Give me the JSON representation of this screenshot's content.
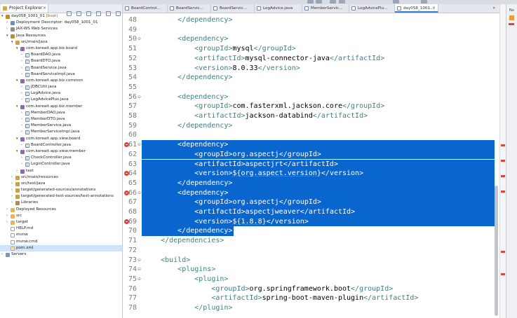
{
  "project_explorer": {
    "tab_label": "Project Explorer",
    "items": [
      {
        "label": "day058_1001_01",
        "suffix": "[boot]",
        "indent": 0,
        "arrow": "▾",
        "icon": "project-icon",
        "cls": "proj"
      },
      {
        "label": "Deployment Descriptor: day058_1001_01",
        "indent": 1,
        "arrow": "›",
        "icon": "deployment-descriptor-icon",
        "cls": "dd"
      },
      {
        "label": "JAX-WS Web Services",
        "indent": 1,
        "arrow": "›",
        "icon": "web-services-icon",
        "cls": "ws"
      },
      {
        "label": "Java Resources",
        "indent": 1,
        "arrow": "▾",
        "icon": "java-resources-icon",
        "cls": "jr"
      },
      {
        "label": "src/main/java",
        "indent": 2,
        "arrow": "▾",
        "icon": "source-folder-icon",
        "cls": "srcf"
      },
      {
        "label": "com.koreait.app.biz.board",
        "indent": 3,
        "arrow": "▾",
        "icon": "package-icon",
        "cls": "pkg"
      },
      {
        "label": "BoardDAO.java",
        "indent": 4,
        "arrow": "›",
        "icon": "java-file-icon",
        "cls": "jf"
      },
      {
        "label": "BoardDTO.java",
        "indent": 4,
        "arrow": "›",
        "icon": "java-file-icon",
        "cls": "jf"
      },
      {
        "label": "BoardService.java",
        "indent": 4,
        "arrow": "›",
        "icon": "java-file-icon",
        "cls": "jf"
      },
      {
        "label": "BoardServiceImpl.java",
        "indent": 4,
        "arrow": "›",
        "icon": "java-file-icon",
        "cls": "jf"
      },
      {
        "label": "com.koreait.app.biz.common",
        "indent": 3,
        "arrow": "▾",
        "icon": "package-icon",
        "cls": "pkg"
      },
      {
        "label": "JDBCUtil.java",
        "indent": 4,
        "arrow": "›",
        "icon": "java-file-icon",
        "cls": "jf"
      },
      {
        "label": "LogAdvice.java",
        "indent": 4,
        "arrow": "›",
        "icon": "java-file-icon",
        "cls": "jf"
      },
      {
        "label": "LogAdvicePlus.java",
        "indent": 4,
        "arrow": "›",
        "icon": "java-file-icon",
        "cls": "jf"
      },
      {
        "label": "com.koreait.app.biz.member",
        "indent": 3,
        "arrow": "▾",
        "icon": "package-icon",
        "cls": "pkg"
      },
      {
        "label": "MemberDAO.java",
        "indent": 4,
        "arrow": "›",
        "icon": "java-file-icon",
        "cls": "jf"
      },
      {
        "label": "MemberDTO.java",
        "indent": 4,
        "arrow": "›",
        "icon": "java-file-icon",
        "cls": "jf"
      },
      {
        "label": "MemberService.java",
        "indent": 4,
        "arrow": "›",
        "icon": "java-file-icon",
        "cls": "jf"
      },
      {
        "label": "MemberServiceImpl.java",
        "indent": 4,
        "arrow": "›",
        "icon": "java-file-icon",
        "cls": "jf"
      },
      {
        "label": "com.koreait.app.view.board",
        "indent": 3,
        "arrow": "▾",
        "icon": "package-icon",
        "cls": "pkg"
      },
      {
        "label": "BoardController.java",
        "indent": 4,
        "arrow": "›",
        "icon": "java-file-icon",
        "cls": "jf"
      },
      {
        "label": "com.koreait.app.view.member",
        "indent": 3,
        "arrow": "▾",
        "icon": "package-icon",
        "cls": "pkg"
      },
      {
        "label": "CheckController.java",
        "indent": 4,
        "arrow": "›",
        "icon": "java-file-icon",
        "cls": "jf"
      },
      {
        "label": "LoginController.java",
        "indent": 4,
        "arrow": "›",
        "icon": "java-file-icon",
        "cls": "jf"
      },
      {
        "label": "test",
        "indent": 3,
        "arrow": "›",
        "icon": "package-icon",
        "cls": "pkg"
      },
      {
        "label": "src/main/resources",
        "indent": 2,
        "arrow": "›",
        "icon": "source-folder-icon",
        "cls": "srcf"
      },
      {
        "label": "src/test/java",
        "indent": 2,
        "arrow": "›",
        "icon": "source-folder-icon",
        "cls": "srcf"
      },
      {
        "label": "target/generated-sources/annotations",
        "indent": 2,
        "arrow": "›",
        "icon": "source-folder-icon",
        "cls": "srcf"
      },
      {
        "label": "target/generated-test-sources/test-annotations",
        "indent": 2,
        "arrow": "›",
        "icon": "source-folder-icon",
        "cls": "srcf"
      },
      {
        "label": "Libraries",
        "indent": 2,
        "arrow": "›",
        "icon": "libraries-icon",
        "cls": "lib"
      },
      {
        "label": "Deployed Resources",
        "indent": 1,
        "arrow": "›",
        "icon": "folder-icon",
        "cls": "fold"
      },
      {
        "label": "src",
        "indent": 1,
        "arrow": "›",
        "icon": "folder-icon",
        "cls": "fold"
      },
      {
        "label": "target",
        "indent": 1,
        "arrow": "›",
        "icon": "folder-icon",
        "cls": "fold"
      },
      {
        "label": "HELP.md",
        "indent": 1,
        "arrow": "",
        "icon": "file-icon",
        "cls": "file"
      },
      {
        "label": "mvnw",
        "indent": 1,
        "arrow": "",
        "icon": "file-icon",
        "cls": "file"
      },
      {
        "label": "mvnw.cmd",
        "indent": 1,
        "arrow": "",
        "icon": "file-icon",
        "cls": "file"
      },
      {
        "label": "pom.xml",
        "indent": 1,
        "arrow": "",
        "icon": "xml-file-icon",
        "cls": "xml",
        "selected": true
      },
      {
        "label": "Servers",
        "indent": 0,
        "arrow": "›",
        "icon": "servers-icon",
        "cls": "srv"
      }
    ]
  },
  "editor_tabs": [
    {
      "label": "BoardControl...",
      "active": false
    },
    {
      "label": "BoardServic...",
      "active": false
    },
    {
      "label": "BoardServic...",
      "active": false
    },
    {
      "label": "LogAdvice.java",
      "active": false
    },
    {
      "label": "MemberServic...",
      "active": false
    },
    {
      "label": "LogAdvicePlu...",
      "active": false
    },
    {
      "label": "day058_1001...",
      "active": true
    }
  ],
  "editor_tabs_more": "»",
  "code_lines": [
    {
      "num": "48",
      "indent": 2,
      "parts": [
        [
          "t",
          "</"
        ],
        [
          "tg",
          "dependency"
        ],
        [
          "t",
          ">"
        ]
      ]
    },
    {
      "num": "49",
      "indent": 0,
      "parts": []
    },
    {
      "num": "50",
      "fold": true,
      "indent": 2,
      "parts": [
        [
          "t",
          "<"
        ],
        [
          "tg",
          "dependency"
        ],
        [
          "t",
          ">"
        ]
      ]
    },
    {
      "num": "51",
      "indent": 3,
      "parts": [
        [
          "t",
          "<"
        ],
        [
          "tg",
          "groupId"
        ],
        [
          "t",
          ">"
        ],
        [
          "tx",
          "mysql"
        ],
        [
          "t",
          "</"
        ],
        [
          "tg",
          "groupId"
        ],
        [
          "t",
          ">"
        ]
      ]
    },
    {
      "num": "52",
      "indent": 3,
      "parts": [
        [
          "t",
          "<"
        ],
        [
          "tg",
          "artifactId"
        ],
        [
          "t",
          ">"
        ],
        [
          "tx",
          "mysql-connector-java"
        ],
        [
          "t",
          "</"
        ],
        [
          "tg",
          "artifactId"
        ],
        [
          "t",
          ">"
        ]
      ]
    },
    {
      "num": "53",
      "indent": 3,
      "parts": [
        [
          "t",
          "<"
        ],
        [
          "tg",
          "version"
        ],
        [
          "t",
          ">"
        ],
        [
          "tx",
          "8.0.33"
        ],
        [
          "t",
          "</"
        ],
        [
          "tg",
          "version"
        ],
        [
          "t",
          ">"
        ]
      ]
    },
    {
      "num": "54",
      "indent": 2,
      "parts": [
        [
          "t",
          "</"
        ],
        [
          "tg",
          "dependency"
        ],
        [
          "t",
          ">"
        ]
      ]
    },
    {
      "num": "55",
      "indent": 0,
      "parts": []
    },
    {
      "num": "56",
      "fold": true,
      "indent": 2,
      "parts": [
        [
          "t",
          "<"
        ],
        [
          "tg",
          "dependency"
        ],
        [
          "t",
          ">"
        ]
      ]
    },
    {
      "num": "57",
      "indent": 3,
      "parts": [
        [
          "t",
          "<"
        ],
        [
          "tg",
          "groupId"
        ],
        [
          "t",
          ">"
        ],
        [
          "tx",
          "com.fasterxml.jackson.core"
        ],
        [
          "t",
          "</"
        ],
        [
          "tg",
          "groupId"
        ],
        [
          "t",
          ">"
        ]
      ]
    },
    {
      "num": "58",
      "indent": 3,
      "parts": [
        [
          "t",
          "<"
        ],
        [
          "tg",
          "artifactId"
        ],
        [
          "t",
          ">"
        ],
        [
          "tx",
          "jackson-databind"
        ],
        [
          "t",
          "</"
        ],
        [
          "tg",
          "artifactId"
        ],
        [
          "t",
          ">"
        ]
      ]
    },
    {
      "num": "59",
      "indent": 2,
      "parts": [
        [
          "t",
          "</"
        ],
        [
          "tg",
          "dependency"
        ],
        [
          "t",
          ">"
        ]
      ]
    },
    {
      "num": "60",
      "indent": 0,
      "parts": []
    },
    {
      "num": "61",
      "fold": true,
      "error": true,
      "sel": true,
      "indent": 2,
      "parts": [
        [
          "t",
          "<"
        ],
        [
          "tg",
          "dependency"
        ],
        [
          "t",
          ">"
        ]
      ]
    },
    {
      "num": "62",
      "sel": true,
      "indent": 3,
      "parts": [
        [
          "t",
          "<"
        ],
        [
          "tg",
          "groupId"
        ],
        [
          "t",
          ">"
        ],
        [
          "tx",
          "org.aspectj"
        ],
        [
          "t",
          "</"
        ],
        [
          "tg",
          "groupId"
        ],
        [
          "t",
          ">"
        ]
      ]
    },
    {
      "num": "63",
      "sel": true,
      "indent": 3,
      "parts": [
        [
          "t",
          "<"
        ],
        [
          "tg",
          "artifactId"
        ],
        [
          "t",
          ">"
        ],
        [
          "tx",
          "aspectjrt"
        ],
        [
          "t",
          "</"
        ],
        [
          "tg",
          "artifactId"
        ],
        [
          "t",
          ">"
        ]
      ]
    },
    {
      "num": "64",
      "error": true,
      "sel": true,
      "indent": 3,
      "parts": [
        [
          "t",
          "<"
        ],
        [
          "tg",
          "version"
        ],
        [
          "t",
          ">"
        ],
        [
          "tx",
          "${org.aspect.version}"
        ],
        [
          "t",
          "</"
        ],
        [
          "tg",
          "version"
        ],
        [
          "t",
          ">"
        ]
      ]
    },
    {
      "num": "65",
      "sel": true,
      "indent": 2,
      "parts": [
        [
          "t",
          "</"
        ],
        [
          "tg",
          "dependency"
        ],
        [
          "t",
          ">"
        ]
      ]
    },
    {
      "num": "66",
      "fold": true,
      "error": true,
      "sel": true,
      "indent": 2,
      "parts": [
        [
          "t",
          "<"
        ],
        [
          "tg",
          "dependency"
        ],
        [
          "t",
          ">"
        ]
      ]
    },
    {
      "num": "67",
      "sel": true,
      "indent": 3,
      "parts": [
        [
          "t",
          "<"
        ],
        [
          "tg",
          "groupId"
        ],
        [
          "t",
          ">"
        ],
        [
          "tx",
          "org.aspectj"
        ],
        [
          "t",
          "</"
        ],
        [
          "tg",
          "groupId"
        ],
        [
          "t",
          ">"
        ]
      ]
    },
    {
      "num": "68",
      "sel": true,
      "indent": 3,
      "parts": [
        [
          "t",
          "<"
        ],
        [
          "tg",
          "artifactId"
        ],
        [
          "t",
          ">"
        ],
        [
          "tx",
          "aspectjweaver"
        ],
        [
          "t",
          "</"
        ],
        [
          "tg",
          "artifactId"
        ],
        [
          "t",
          ">"
        ]
      ]
    },
    {
      "num": "69",
      "error": true,
      "sel": true,
      "indent": 3,
      "parts": [
        [
          "t",
          "<"
        ],
        [
          "tg",
          "version"
        ],
        [
          "t",
          ">"
        ],
        [
          "tx",
          "${1.8.8}"
        ],
        [
          "t",
          "</"
        ],
        [
          "tg",
          "version"
        ],
        [
          "t",
          ">"
        ]
      ]
    },
    {
      "num": "70",
      "sel": true,
      "selpartial": true,
      "indent": 2,
      "parts": [
        [
          "t",
          "</"
        ],
        [
          "tg",
          "dependency"
        ],
        [
          "t",
          ">"
        ]
      ]
    },
    {
      "num": "71",
      "indent": 1,
      "parts": [
        [
          "t",
          "</"
        ],
        [
          "tg",
          "dependencies"
        ],
        [
          "t",
          ">"
        ]
      ]
    },
    {
      "num": "72",
      "indent": 0,
      "parts": []
    },
    {
      "num": "73",
      "fold": true,
      "indent": 1,
      "parts": [
        [
          "t",
          "<"
        ],
        [
          "tg",
          "build"
        ],
        [
          "t",
          ">"
        ]
      ]
    },
    {
      "num": "74",
      "fold": true,
      "indent": 2,
      "parts": [
        [
          "t",
          "<"
        ],
        [
          "tg",
          "plugins"
        ],
        [
          "t",
          ">"
        ]
      ]
    },
    {
      "num": "75",
      "fold": true,
      "indent": 3,
      "parts": [
        [
          "t",
          "<"
        ],
        [
          "tg",
          "plugin"
        ],
        [
          "t",
          ">"
        ]
      ]
    },
    {
      "num": "76",
      "indent": 4,
      "parts": [
        [
          "t",
          "<"
        ],
        [
          "tg",
          "groupId"
        ],
        [
          "t",
          ">"
        ],
        [
          "tx",
          "org.springframework.boot"
        ],
        [
          "t",
          "</"
        ],
        [
          "tg",
          "groupId"
        ],
        [
          "t",
          ">"
        ]
      ]
    },
    {
      "num": "77",
      "indent": 4,
      "parts": [
        [
          "t",
          "<"
        ],
        [
          "tg",
          "artifactId"
        ],
        [
          "t",
          ">"
        ],
        [
          "tx",
          "spring-boot-maven-plugin"
        ],
        [
          "t",
          "</"
        ],
        [
          "tg",
          "artifactId"
        ],
        [
          "t",
          ">"
        ]
      ]
    },
    {
      "num": "78",
      "indent": 3,
      "parts": [
        [
          "t",
          "</"
        ],
        [
          "tg",
          "plugin"
        ],
        [
          "t",
          ">"
        ]
      ]
    }
  ],
  "side_panel_label": "No"
}
